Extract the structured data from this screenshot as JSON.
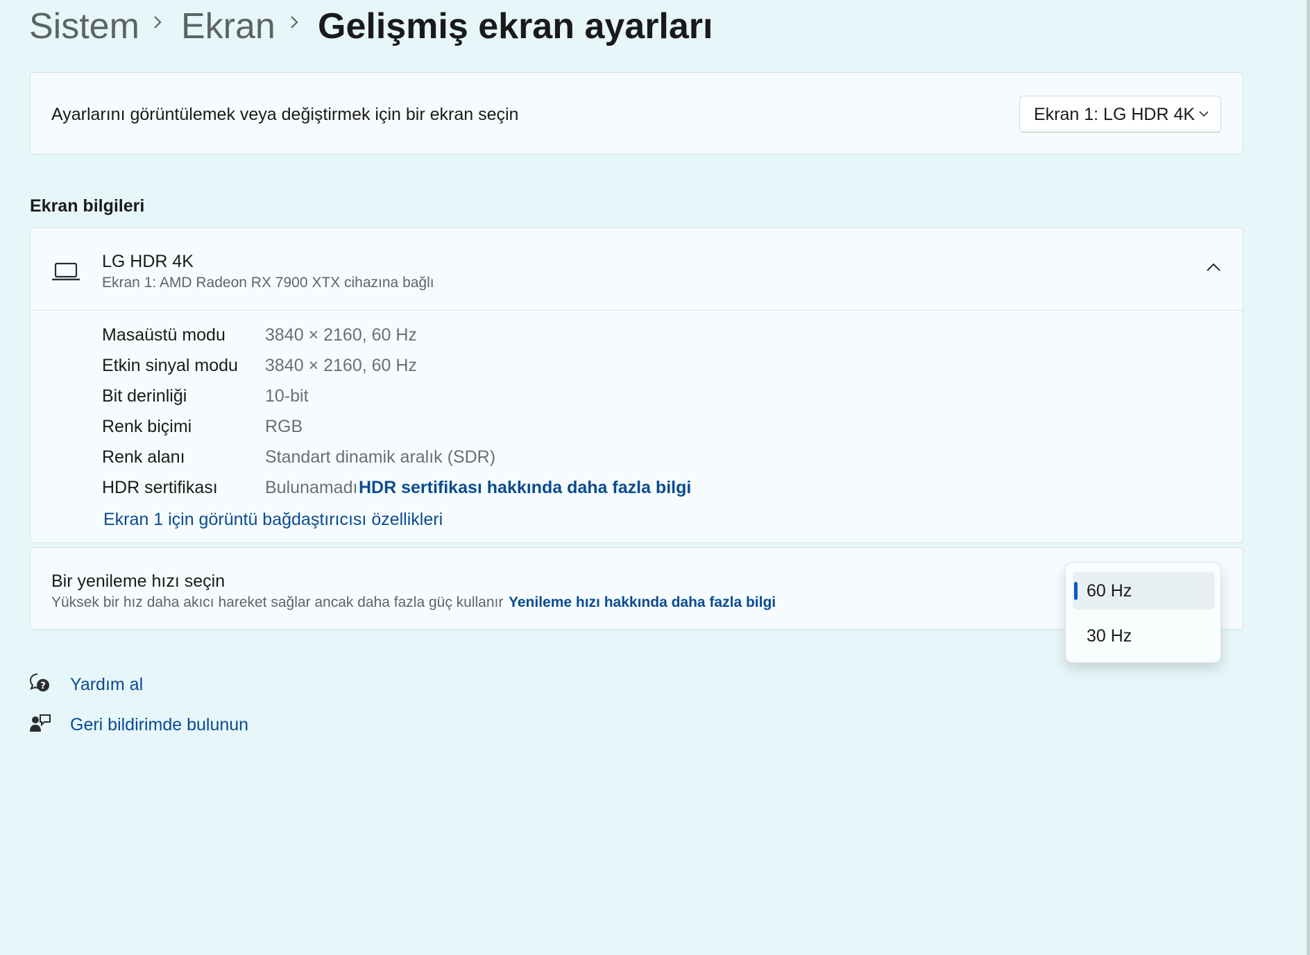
{
  "breadcrumb": {
    "items": [
      "Sistem",
      "Ekran"
    ],
    "current": "Gelişmiş ekran ayarları"
  },
  "display_select": {
    "label": "Ayarlarını görüntülemek veya değiştirmek için bir ekran seçin",
    "value": "Ekran 1: LG HDR 4K"
  },
  "display_info": {
    "section_title": "Ekran bilgileri",
    "monitor_name": "LG HDR 4K",
    "monitor_subtitle": "Ekran 1: AMD Radeon RX 7900 XTX cihazına bağlı",
    "rows": [
      {
        "label": "Masaüstü modu",
        "value": "3840 × 2160, 60 Hz"
      },
      {
        "label": "Etkin sinyal modu",
        "value": "3840 × 2160, 60 Hz"
      },
      {
        "label": "Bit derinliği",
        "value": "10-bit"
      },
      {
        "label": "Renk biçimi",
        "value": "RGB"
      },
      {
        "label": "Renk alanı",
        "value": "Standart dinamik aralık (SDR)"
      },
      {
        "label": "HDR sertifikası",
        "value": "Bulunamadı",
        "link": "HDR sertifikası hakkında daha fazla bilgi"
      }
    ],
    "adapter_link": "Ekran 1 için görüntü bağdaştırıcısı özellikleri"
  },
  "refresh_rate": {
    "title": "Bir yenileme hızı seçin",
    "subtitle": "Yüksek bir hız daha akıcı hareket sağlar ancak daha fazla güç kullanır",
    "link": "Yenileme hızı hakkında daha fazla bilgi",
    "options": [
      "60 Hz",
      "30 Hz"
    ],
    "selected": "60 Hz"
  },
  "footer": {
    "help": "Yardım al",
    "feedback": "Geri bildirimde bulunun"
  },
  "icons": {
    "chevron": "chevron-right-icon",
    "laptop": "laptop-icon",
    "collapse": "chevron-up-icon",
    "dropdown": "chevron-down-icon",
    "help": "help-icon",
    "feedback": "feedback-icon"
  },
  "colors": {
    "background": "#e6f6f9",
    "card": "#f6fcfd",
    "link": "#0b4a92",
    "accent": "#0a5bbf"
  }
}
